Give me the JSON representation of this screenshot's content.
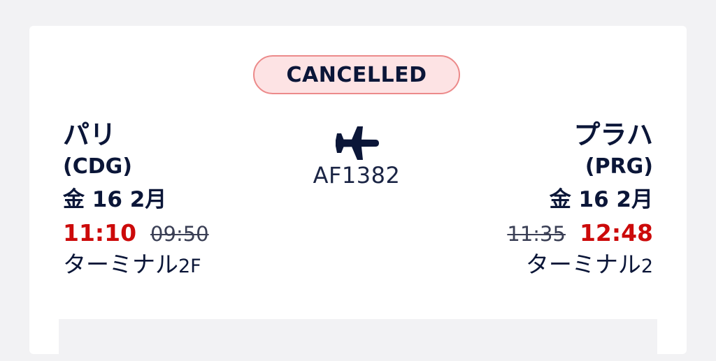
{
  "status": {
    "label": "CANCELLED",
    "colors": {
      "background": "#fde3e4",
      "border": "#ec8a8a"
    }
  },
  "departure": {
    "city": "パリ",
    "code": "(CDG)",
    "date": "金 16 2月",
    "new_time": "11:10",
    "scheduled_time": "09:50",
    "terminal_label": "ターミナル",
    "terminal_code": "2F"
  },
  "arrival": {
    "city": "プラハ",
    "code": "(PRG)",
    "date": "金 16 2月",
    "scheduled_time": "11:35",
    "new_time": "12:48",
    "terminal_label": "ターミナル",
    "terminal_code": "2"
  },
  "flight": {
    "number": "AF1382",
    "icon": "airplane-icon"
  },
  "colors": {
    "text": "#0b1638",
    "delay_red": "#cc0a0a",
    "background": "#f2f2f4"
  }
}
